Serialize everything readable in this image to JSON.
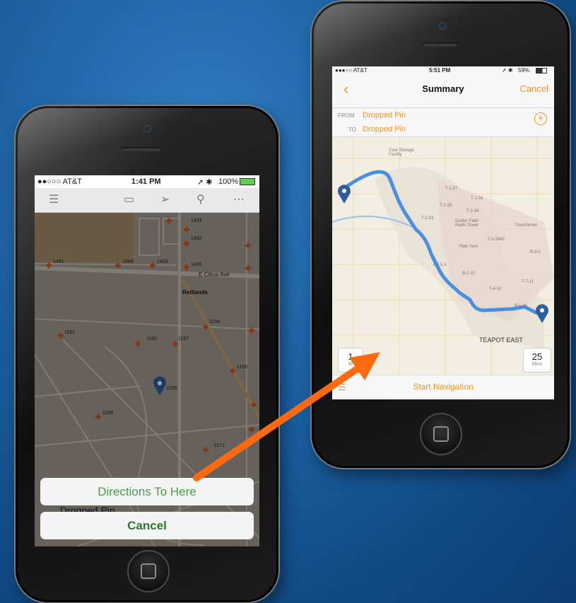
{
  "left_phone": {
    "status": {
      "carrier": "●●○○○ AT&T",
      "time": "1:41 PM",
      "battery": "100%"
    },
    "toolbar_icons": [
      "menu-icon",
      "book-icon",
      "location-arrow-icon",
      "search-icon",
      "more-icon"
    ],
    "map_labels": {
      "street": "E Citrus Ave",
      "city": "Redlands",
      "parcels": [
        "1433",
        "1432",
        "1435",
        "1441",
        "1469",
        "1403",
        "1161",
        "1160",
        "1157",
        "1154",
        "1155",
        "1158",
        "1169",
        "1172"
      ]
    },
    "callout_title": "Dropped Pin",
    "actions": {
      "directions": "Directions To Here",
      "cancel": "Cancel"
    }
  },
  "right_phone": {
    "status": {
      "carrier": "●●●○○ AT&T",
      "time": "5:51 PM",
      "battery": "59%"
    },
    "nav": {
      "title": "Summary",
      "cancel": "Cancel"
    },
    "route": {
      "from_label": "FROM",
      "from_value": "Dropped Pin",
      "to_label": "TO",
      "to_value": "Dropped Pin"
    },
    "map_labels": [
      "Core Storage Facility",
      "T-1-27",
      "T-1-33",
      "T-1-34",
      "T-2-34",
      "T-2-33",
      "Center Field Radio Tower",
      "Transformer",
      "T-3-3/M2",
      "Pipe Yard",
      "B-3-2",
      "ES-1-1",
      "B-1-10",
      "T-7-11",
      "T-4-10",
      "B-1-14",
      "TEAPOT EAST"
    ],
    "distance_card": {
      "value": "1",
      "unit": "M"
    },
    "time_card": {
      "value": "25",
      "unit": "Mins"
    },
    "start_button": "Start Navigation"
  },
  "colors": {
    "accent_orange": "#f0961e",
    "route_blue": "#4a90e0",
    "pin_blue": "#2e5e9e",
    "arrow": "#ff6a10",
    "green": "#4c9a4c"
  }
}
